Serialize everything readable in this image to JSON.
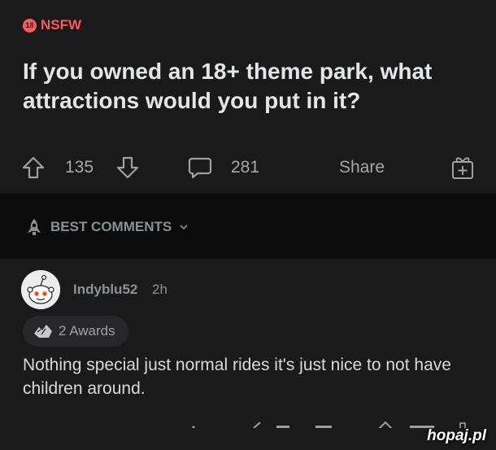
{
  "post": {
    "nsfw_label": "NSFW",
    "nsfw_badge": "18",
    "title": "If you owned an 18+ theme park, what attractions would you put in it?",
    "upvotes": "135",
    "comments": "281",
    "share_label": "Share"
  },
  "comments_section": {
    "sort_label": "BEST COMMENTS"
  },
  "comment": {
    "username": "Indyblu52",
    "age": "2h",
    "awards_label": "2 Awards",
    "body": "Nothing special just normal rides it's just nice to not have children around."
  },
  "watermark": {
    "text": "hopaj.pl"
  },
  "icons": {
    "upvote": "upvote-arrow-icon",
    "downvote": "downvote-arrow-icon",
    "comment": "comment-bubble-icon",
    "gift": "gift-award-icon",
    "rocket": "rocket-icon",
    "chevron": "chevron-down-icon",
    "award": "award-icon"
  },
  "colors": {
    "nsfw": "#ff585b",
    "card_bg": "#1a1a1b",
    "page_bg": "#0b0b0b"
  }
}
